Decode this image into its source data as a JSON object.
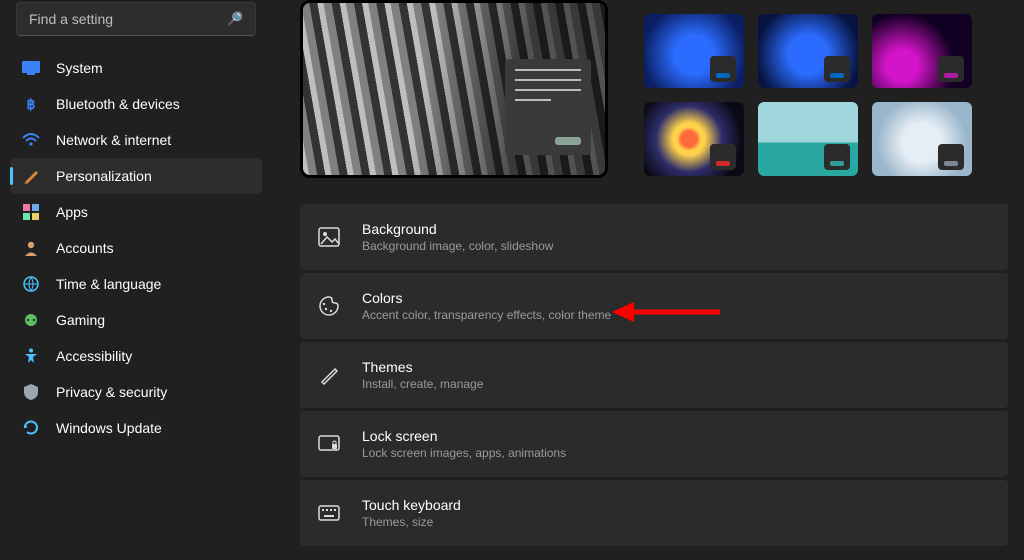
{
  "search": {
    "placeholder": "Find a setting"
  },
  "sidebar": {
    "items": [
      {
        "label": "System"
      },
      {
        "label": "Bluetooth & devices"
      },
      {
        "label": "Network & internet"
      },
      {
        "label": "Personalization"
      },
      {
        "label": "Apps"
      },
      {
        "label": "Accounts"
      },
      {
        "label": "Time & language"
      },
      {
        "label": "Gaming"
      },
      {
        "label": "Accessibility"
      },
      {
        "label": "Privacy & security"
      },
      {
        "label": "Windows Update"
      }
    ]
  },
  "themes": [
    {
      "accent": "#0067c0"
    },
    {
      "accent": "#0067c0"
    },
    {
      "accent": "#b01ba5"
    },
    {
      "accent": "#cf2b2b"
    },
    {
      "accent": "#2f9e99"
    },
    {
      "accent": "#7b8794"
    }
  ],
  "cards": [
    {
      "title": "Background",
      "sub": "Background image, color, slideshow"
    },
    {
      "title": "Colors",
      "sub": "Accent color, transparency effects, color theme"
    },
    {
      "title": "Themes",
      "sub": "Install, create, manage"
    },
    {
      "title": "Lock screen",
      "sub": "Lock screen images, apps, animations"
    },
    {
      "title": "Touch keyboard",
      "sub": "Themes, size"
    }
  ]
}
